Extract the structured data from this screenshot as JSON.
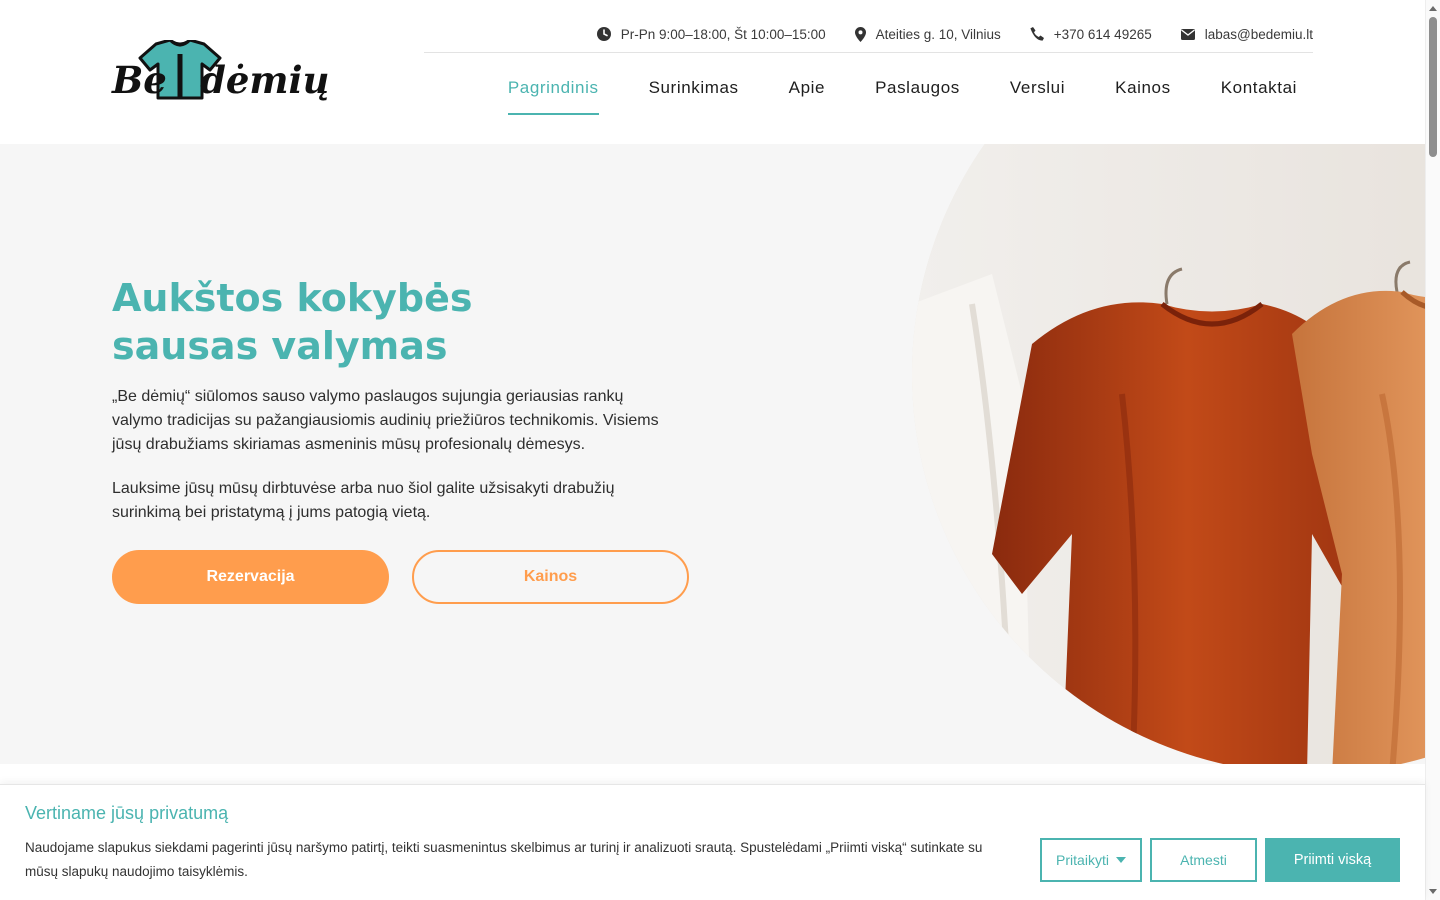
{
  "brand": {
    "logo_text_left": "Be",
    "logo_text_right": "dėmių",
    "shirt_color": "#4bb4b0"
  },
  "topbar": {
    "hours": "Pr-Pn 9:00–18:00, Št 10:00–15:00",
    "address": "Ateities g. 10, Vilnius",
    "phone": "+370 614 49265",
    "email": "labas@bedemiu.lt"
  },
  "nav": {
    "items": [
      {
        "label": "Pagrindinis",
        "active": true
      },
      {
        "label": "Surinkimas"
      },
      {
        "label": "Apie"
      },
      {
        "label": "Paslaugos"
      },
      {
        "label": "Verslui"
      },
      {
        "label": "Kainos"
      },
      {
        "label": "Kontaktai"
      }
    ]
  },
  "hero": {
    "title_line1": "Aukštos kokybės",
    "title_line2": "sausas valymas",
    "paragraph1": "„Be dėmių“ siūlomos sauso valymo paslaugos sujungia geriausias rankų valymo tradicijas su pažangiausiomis audinių priežiūros technikomis. Visiems jūsų drabužiams skiriamas asmeninis mūsų profesionalų dėmesys.",
    "paragraph2": "Lauksime jūsų mūsų dirbtuvėse arba nuo šiol galite užsisakyti drabužių surinkimą bei pristatymą į jums patogią vietą.",
    "primary_button": "Rezervacija",
    "secondary_button": "Kainos"
  },
  "cookie": {
    "title": "Vertiname jūsų privatumą",
    "text": "Naudojame slapukus siekdami pagerinti jūsų naršymo patirtį, teikti suasmenintus skelbimus ar turinį ir analizuoti srautą. Spustelėdami „Priimti viską“ sutinkate su mūsų slapukų naudojimo taisyklėmis.",
    "customize": "Pritaikyti",
    "reject": "Atmesti",
    "accept": "Priimti viską"
  },
  "colors": {
    "accent": "#4bb4b0",
    "orange": "#ff9d4d",
    "hero_bg": "#f6f6f6"
  }
}
